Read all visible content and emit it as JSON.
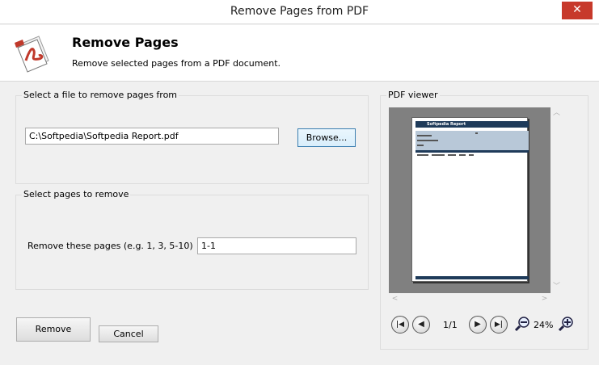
{
  "window": {
    "title": "Remove Pages from PDF",
    "close_glyph": "✕"
  },
  "header": {
    "title": "Remove Pages",
    "subtitle": "Remove selected pages from a PDF document.",
    "logo_icon": "pdf-document-icon"
  },
  "file_group": {
    "legend": "Select a file to remove pages from",
    "path_value": "C:\\Softpedia\\Softpedia Report.pdf",
    "browse_label": "Browse..."
  },
  "pages_group": {
    "legend": "Select pages to remove",
    "range_label": "Remove these pages (e.g. 1, 3, 5-10)",
    "range_value": "1-1"
  },
  "viewer": {
    "legend": "PDF viewer",
    "page_header_text": "Softpedia Report",
    "page_indicator": "1/1",
    "zoom_level": "24%",
    "first_glyph": "|◀",
    "prev_glyph": "◀",
    "next_glyph": "▶",
    "last_glyph": "▶|",
    "scroll_up": "︿",
    "scroll_down": "﹀",
    "scroll_left": "<",
    "scroll_right": ">"
  },
  "actions": {
    "remove_label": "Remove",
    "cancel_label": "Cancel"
  },
  "colors": {
    "close": "#c7392b",
    "page_bar": "#1f3b5a",
    "viewer_bg": "#808080"
  }
}
